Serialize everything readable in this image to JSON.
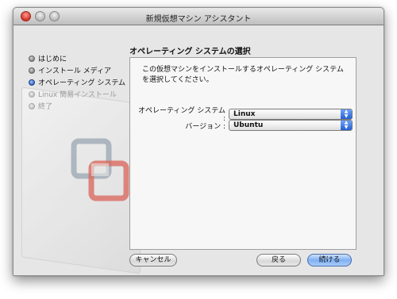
{
  "window": {
    "title": "新規仮想マシン アシスタント"
  },
  "sidebar": {
    "steps": [
      {
        "label": "はじめに",
        "state": "done"
      },
      {
        "label": "インストール メディア",
        "state": "done"
      },
      {
        "label": "オペレーティング システム",
        "state": "current"
      },
      {
        "label": "Linux 簡易インストール",
        "state": "disabled"
      },
      {
        "label": "終了",
        "state": "disabled"
      }
    ]
  },
  "main": {
    "heading": "オペレーティング システムの選択",
    "description": "この仮想マシンをインストールするオペレーティング システムを選択してください。",
    "os_label": "オペレーティング システム :",
    "os_value": "Linux",
    "version_label": "バージョン :",
    "version_value": "Ubuntu"
  },
  "buttons": {
    "cancel": "キャンセル",
    "back": "戻る",
    "continue": "続ける"
  },
  "colors": {
    "accent": "#2c5fb8",
    "logo_gray": "#9aa5b1",
    "logo_red": "#d96b62"
  },
  "icons": {
    "logo": "vmware-logo-icon",
    "popup_arrows": "up-down-arrows-icon"
  }
}
